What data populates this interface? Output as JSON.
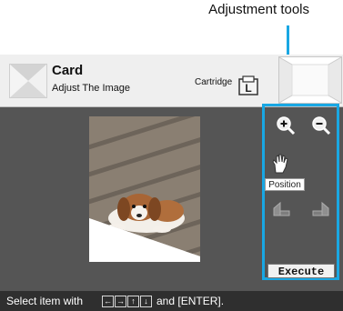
{
  "callout": {
    "label": "Adjustment tools"
  },
  "header": {
    "title": "Card",
    "subtitle": "Adjust The Image",
    "cartridge_label": "Cartridge",
    "cartridge_size": "L"
  },
  "tools": {
    "position_label": "Position",
    "execute_label": "Execute"
  },
  "footer": {
    "text_prefix": "Select item with",
    "arrow_keys": [
      "←",
      "→",
      "↑",
      "↓"
    ],
    "text_suffix": "and [ENTER]."
  },
  "colors": {
    "accent": "#19a7e3",
    "workspace_bg": "#555555",
    "footer_bg": "#2f2f2f"
  },
  "icons": [
    "zoom-in-icon",
    "zoom-out-icon",
    "hand-icon",
    "rotate-left-icon",
    "rotate-right-icon",
    "cartridge-icon"
  ]
}
